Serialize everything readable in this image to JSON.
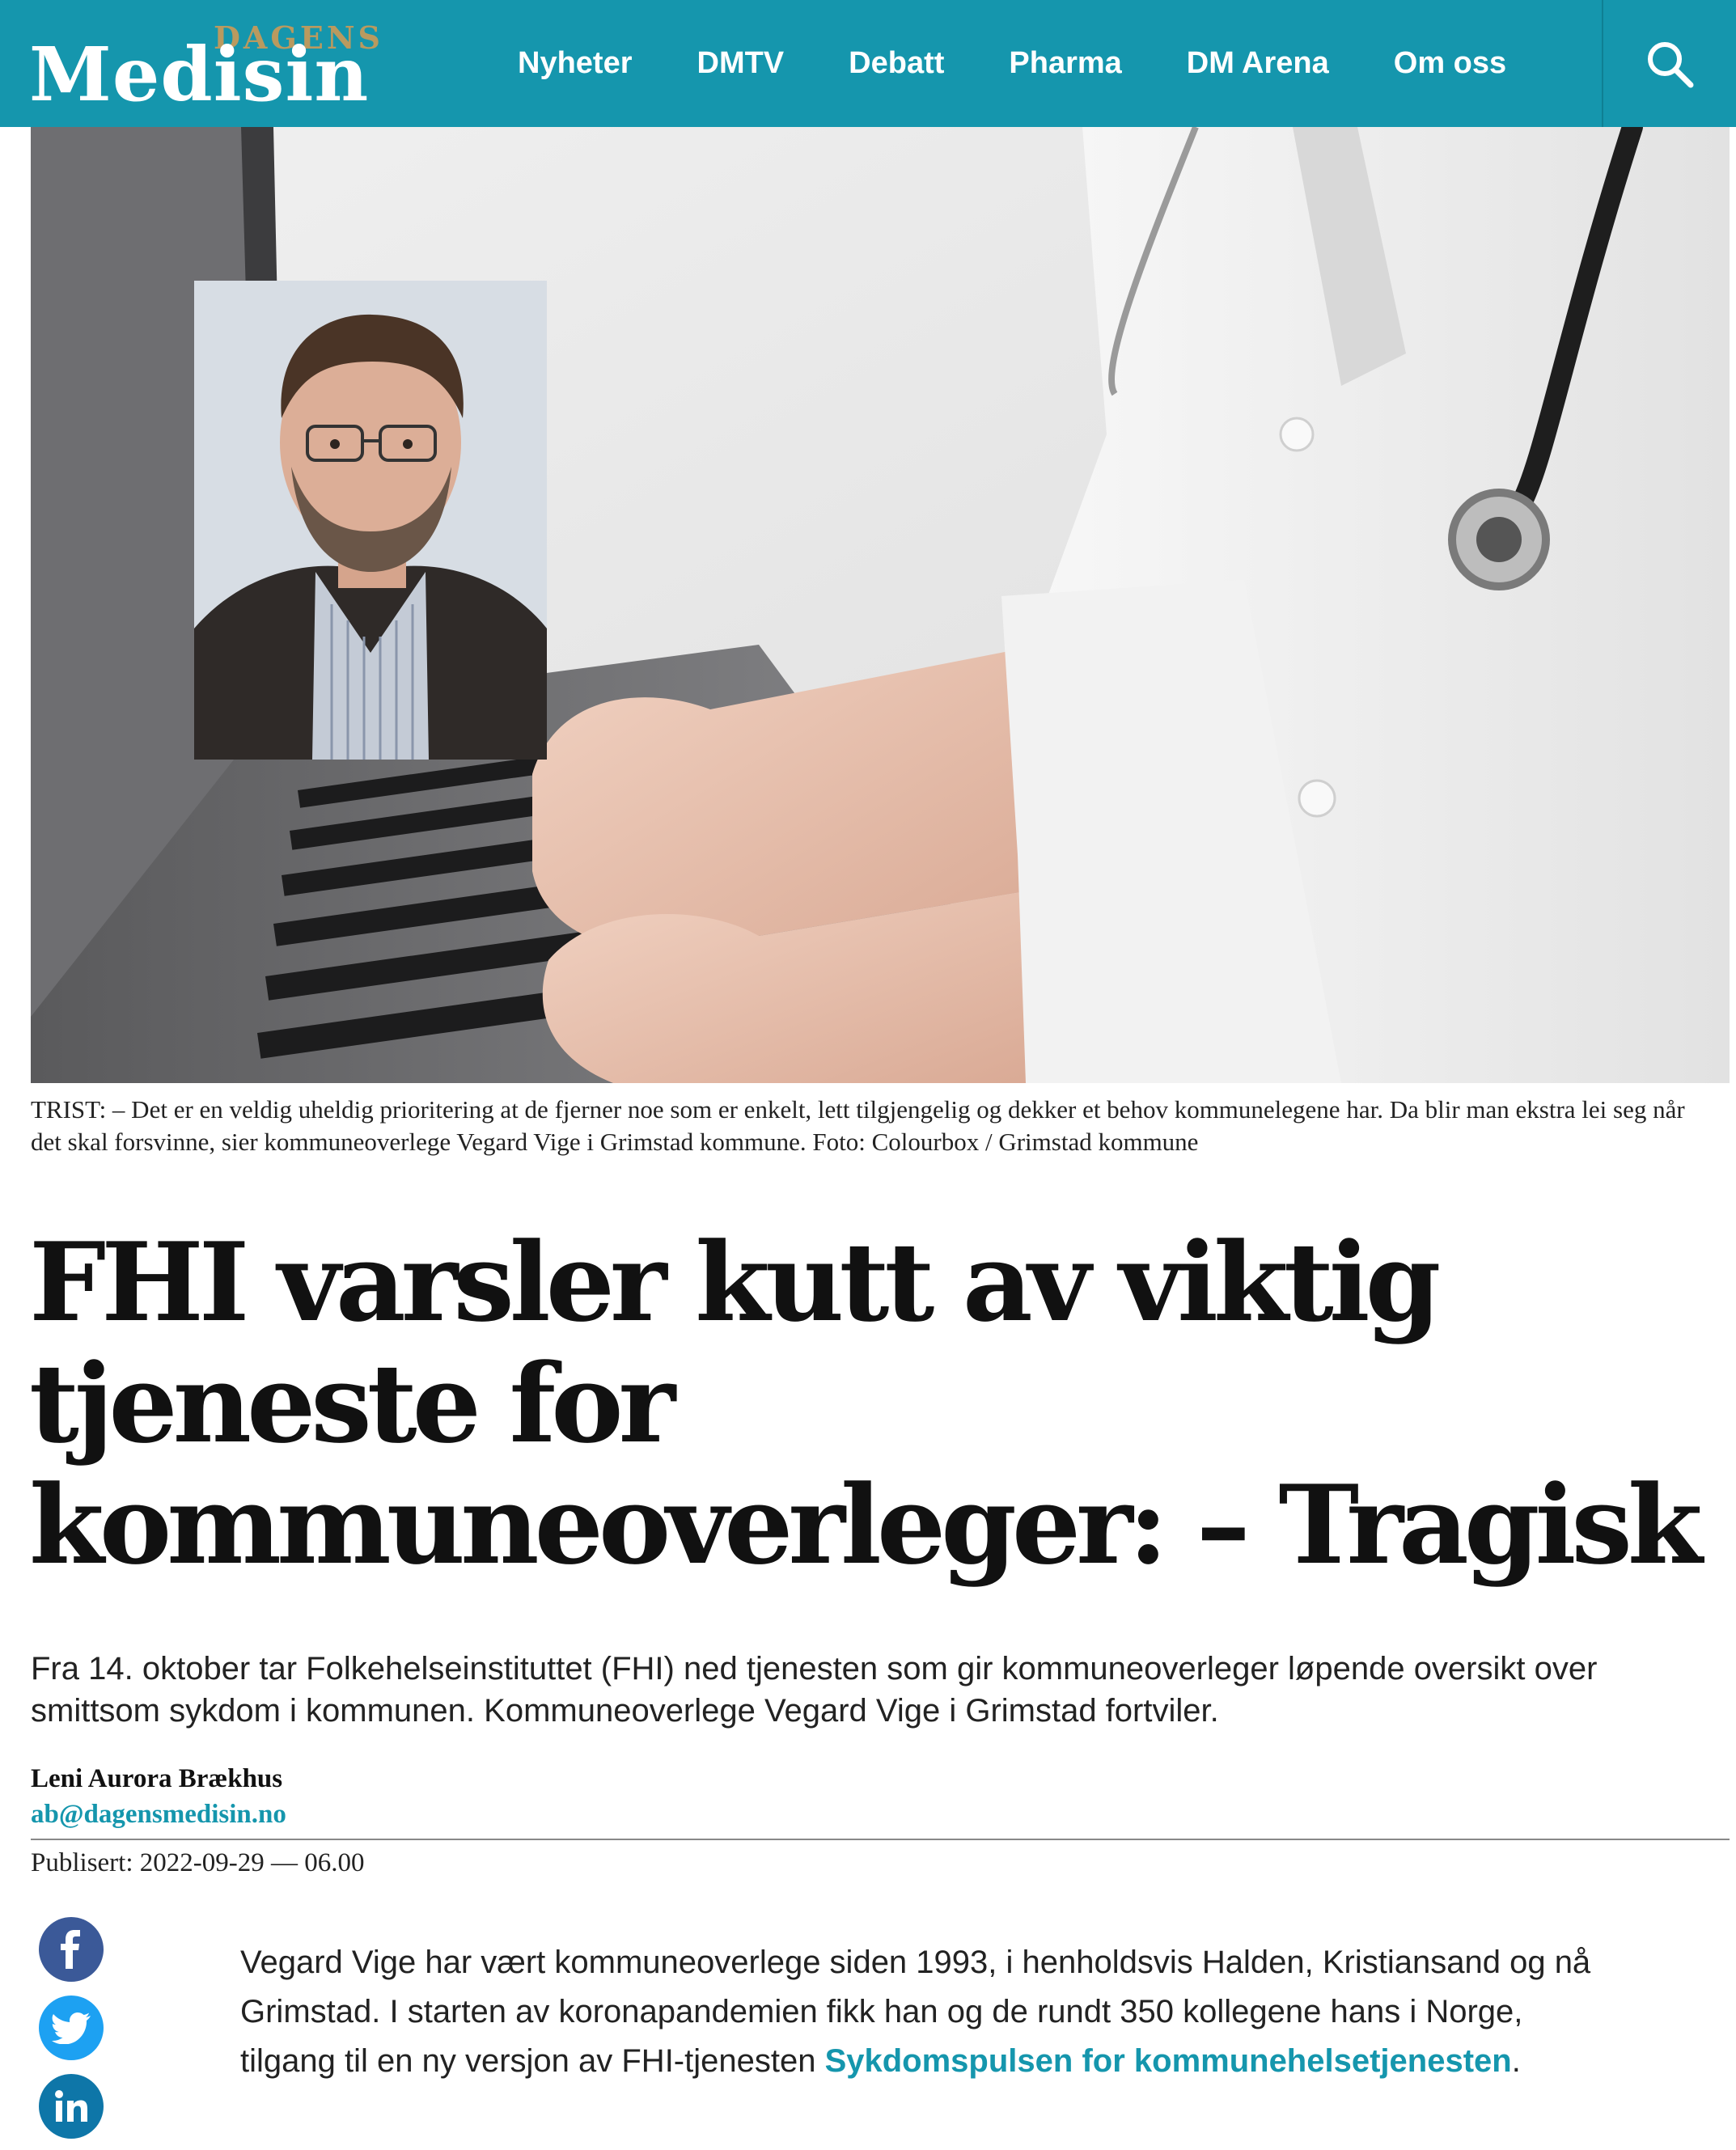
{
  "header": {
    "logo_small": "DAGENS",
    "logo_big": "Medisin",
    "nav": [
      "Nyheter",
      "DMTV",
      "Debatt",
      "Pharma",
      "DM Arena",
      "Om oss"
    ],
    "search_icon": "search-icon",
    "brand_color": "#1596ad"
  },
  "hero": {
    "caption": "TRIST: – Det er en veldig uheldig prioritering at de fjerner noe som er enkelt, lett tilgjengelig og dekker et behov kommunelegene har. Da blir man ekstra lei seg når det skal forsvinne, sier kommuneoverlege Vegard Vige i Grimstad kommune. Foto: Colourbox / Grimstad kommune"
  },
  "article": {
    "headline": "FHI varsler kutt av viktig tjeneste for kommuneoverleger: – Tragisk",
    "lead": "Fra 14. oktober tar Folkehelseinstituttet (FHI) ned tjenesten som gir kommuneoverleger løpende oversikt over smittsom sykdom i kommunen. Kommuneoverlege Vegard Vige i Grimstad fortviler.",
    "author": "Leni Aurora Brækhus",
    "email": "ab@dagensmedisin.no",
    "published": "Publisert: 2022-09-29 — 06.00",
    "body_text": "Vegard Vige har vært kommuneoverlege siden 1993, i henholdsvis Halden, Kristiansand og nå Grimstad. I starten av koronapandemien fikk han og de rundt 350 kollegene hans i Norge, tilgang til en ny versjon av FHI-tjenesten ",
    "body_link": "Sykdomspulsen for kommunehelsetjenesten",
    "body_end": "."
  },
  "share": {
    "facebook_icon": "facebook-icon",
    "twitter_icon": "twitter-icon",
    "linkedin_icon": "linkedin-icon",
    "facebook_color": "#3b5998",
    "twitter_color": "#1da1f2",
    "linkedin_color": "#0e76a8"
  }
}
